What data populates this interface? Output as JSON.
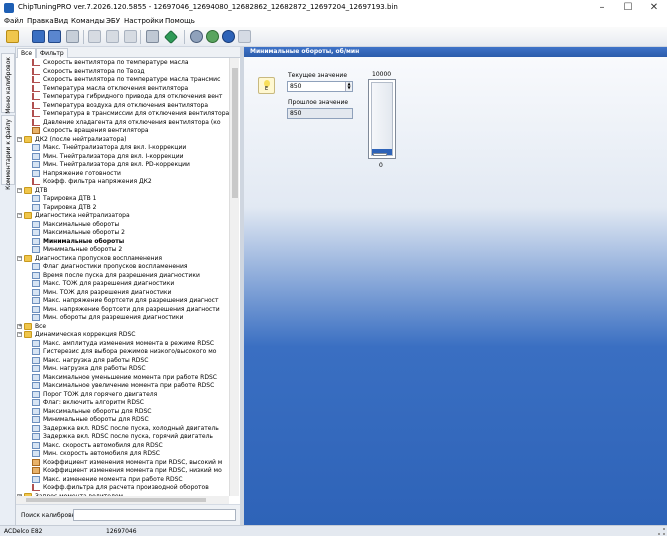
{
  "window": {
    "title": "ChipTuningPRO ver.7.2026.120.5855 - 12697046_12694080_12682862_12682872_12697204_12697193.bin"
  },
  "menu": [
    "Файл",
    "Правка",
    "Вид",
    "Команды",
    "ЭБУ",
    "Настройки",
    "Помощь"
  ],
  "vertical_tabs": [
    "Меню калибровок",
    "Комментарии к файлу"
  ],
  "panel_tabs": [
    "Все",
    "Фильтр"
  ],
  "tree": [
    {
      "level": 3,
      "icon": "k1",
      "label": "Скорость вентилятора по температуре масла"
    },
    {
      "level": 3,
      "icon": "k1",
      "label": "Скорость вентилятора по Твозд"
    },
    {
      "level": 3,
      "icon": "k1",
      "label": "Скорость вентилятора по температуре масла трансмис"
    },
    {
      "level": 3,
      "icon": "k1",
      "label": "Температура масла отключения вентилятора"
    },
    {
      "level": 3,
      "icon": "k1",
      "label": "Температура гибридного привода для отключения вент"
    },
    {
      "level": 3,
      "icon": "k1",
      "label": "Температура воздуха для отключения вентилятора"
    },
    {
      "level": 3,
      "icon": "k1",
      "label": "Температура в трансмиссии для отключения вентилятора"
    },
    {
      "level": 3,
      "icon": "k1",
      "label": "Давление хладагента для отключения вентилятора (ко"
    },
    {
      "level": 3,
      "icon": "k3",
      "label": "Скорость вращения вентилятора"
    },
    {
      "level": 2,
      "icon": "folder",
      "label": "ДК2 (после нейтрализатора)",
      "expanded": true
    },
    {
      "level": 3,
      "icon": "k2",
      "label": "Макс. Тнейтрализатора для вкл. I-коррекции"
    },
    {
      "level": 3,
      "icon": "k2",
      "label": "Мин. Тнейтрализатора для вкл. I-коррекции"
    },
    {
      "level": 3,
      "icon": "k2",
      "label": "Мин. Тнейтрализатора для вкл. PD-коррекции"
    },
    {
      "level": 3,
      "icon": "k2",
      "label": "Напряжение готовности"
    },
    {
      "level": 3,
      "icon": "k1",
      "label": "Коэфф. фильтра напряжения ДК2"
    },
    {
      "level": 2,
      "icon": "folder",
      "label": "ДТВ",
      "expanded": true
    },
    {
      "level": 3,
      "icon": "k2",
      "label": "Тарировка ДТВ 1"
    },
    {
      "level": 3,
      "icon": "k2",
      "label": "Тарировка ДТВ 2"
    },
    {
      "level": 2,
      "icon": "folder",
      "label": "Диагностика нейтрализатора",
      "expanded": true
    },
    {
      "level": 3,
      "icon": "k2",
      "label": "Максимальные обороты"
    },
    {
      "level": 3,
      "icon": "k2",
      "label": "Максимальные обороты 2"
    },
    {
      "level": 3,
      "icon": "k2",
      "label": "Минимальные обороты",
      "selected": true
    },
    {
      "level": 3,
      "icon": "k2",
      "label": "Минимальные обороты 2"
    },
    {
      "level": 2,
      "icon": "folder",
      "label": "Диагностика пропусков воспламенения",
      "expanded": true
    },
    {
      "level": 3,
      "icon": "k2",
      "label": "Флаг диагностики пропусков воспламенения"
    },
    {
      "level": 3,
      "icon": "k2",
      "label": "Время после пуска для разрешения диагностики"
    },
    {
      "level": 3,
      "icon": "k2",
      "label": "Макс. ТОЖ для разрешения диагностики"
    },
    {
      "level": 3,
      "icon": "k2",
      "label": "Мин. ТОЖ для разрешения диагностики"
    },
    {
      "level": 3,
      "icon": "k2",
      "label": "Макс. напряжение бортсети для разрешения диагност"
    },
    {
      "level": 3,
      "icon": "k2",
      "label": "Мин. напряжение бортсети для разрешения диагности"
    },
    {
      "level": 3,
      "icon": "k2",
      "label": "Мин. обороты для разрешения диагностики"
    },
    {
      "level": 2,
      "icon": "folder",
      "label": "Все",
      "expanded": false
    },
    {
      "level": 2,
      "icon": "folder",
      "label": "Динамическая коррекция RDSC",
      "expanded": true
    },
    {
      "level": 3,
      "icon": "k2",
      "label": "Макс. амплитуда изменения момента в режиме RDSC"
    },
    {
      "level": 3,
      "icon": "k2",
      "label": "Гистерезис для выбора режимов низкого/высокого мо"
    },
    {
      "level": 3,
      "icon": "k2",
      "label": "Макс. нагрузка для работы RDSC"
    },
    {
      "level": 3,
      "icon": "k2",
      "label": "Мин. нагрузка для работы RDSC"
    },
    {
      "level": 3,
      "icon": "k2",
      "label": "Максимальное уменьшение момента при работе RDSC"
    },
    {
      "level": 3,
      "icon": "k2",
      "label": "Максимальное увеличение момента при работе RDSC"
    },
    {
      "level": 3,
      "icon": "k2",
      "label": "Порог ТОЖ для горячего двигателя"
    },
    {
      "level": 3,
      "icon": "k2",
      "label": "Флаг: включить алгоритм RDSC"
    },
    {
      "level": 3,
      "icon": "k2",
      "label": "Максимальные обороты для RDSC"
    },
    {
      "level": 3,
      "icon": "k2",
      "label": "Минимальные обороты для RDSC"
    },
    {
      "level": 3,
      "icon": "k2",
      "label": "Задержка вкл. RDSC после пуска, холодный двигатель"
    },
    {
      "level": 3,
      "icon": "k2",
      "label": "Задержка вкл. RDSC после пуска, горячий двигатель"
    },
    {
      "level": 3,
      "icon": "k2",
      "label": "Макс. скорость автомобиля для RDSC"
    },
    {
      "level": 3,
      "icon": "k2",
      "label": "Мин. скорость автомобиля для RDSC"
    },
    {
      "level": 3,
      "icon": "k3",
      "label": "Коэффициент изменения момента при RDSC, высокий м"
    },
    {
      "level": 3,
      "icon": "k3",
      "label": "Коэффициент изменения момента при RDSC, низкий мо"
    },
    {
      "level": 3,
      "icon": "k2",
      "label": "Макс. изменение момента при работе RDSC"
    },
    {
      "level": 3,
      "icon": "k1",
      "label": "Коэфф.фильтра для расчета производной оборотов"
    },
    {
      "level": 2,
      "icon": "folder",
      "label": "Запрос момента водителем",
      "expanded": true
    }
  ],
  "search": {
    "label": "Поиск калибровки",
    "value": ""
  },
  "editor": {
    "header": "Минимальные обороты, об/мин",
    "bulb_letter": "E",
    "current_label": "Текущее значение",
    "current_value": "850",
    "previous_label": "Прошлое значение",
    "previous_value": "850",
    "gauge_max": "10000",
    "gauge_min": "0",
    "gauge_level": 0.085
  },
  "status": {
    "ecu": "ACDelco E82",
    "file_id": "12697046"
  },
  "colors": {
    "accent": "#2e63b8",
    "header_blue": "#2b5cab"
  }
}
